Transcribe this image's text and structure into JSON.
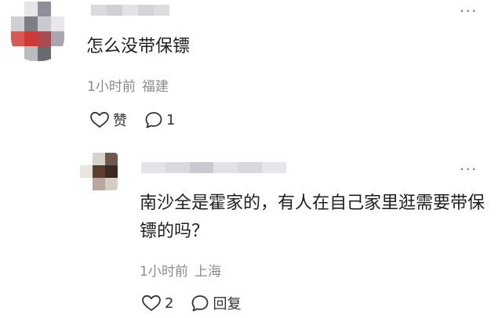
{
  "comments": [
    {
      "text": "怎么没带保镖",
      "time": "1小时前",
      "location": "福建",
      "like_label": "赞",
      "reply_count": "1",
      "more_icon": "more-horizontal-icon"
    },
    {
      "text": "南沙全是霍家的，有人在自己家里逛需要带保镖的吗？",
      "time": "1小时前",
      "location": "上海",
      "like_count": "2",
      "reply_label": "回复",
      "more_icon": "more-horizontal-icon"
    }
  ],
  "colors": {
    "text": "#1f1f1f",
    "meta": "#8a8a8a",
    "icon": "#333333"
  }
}
